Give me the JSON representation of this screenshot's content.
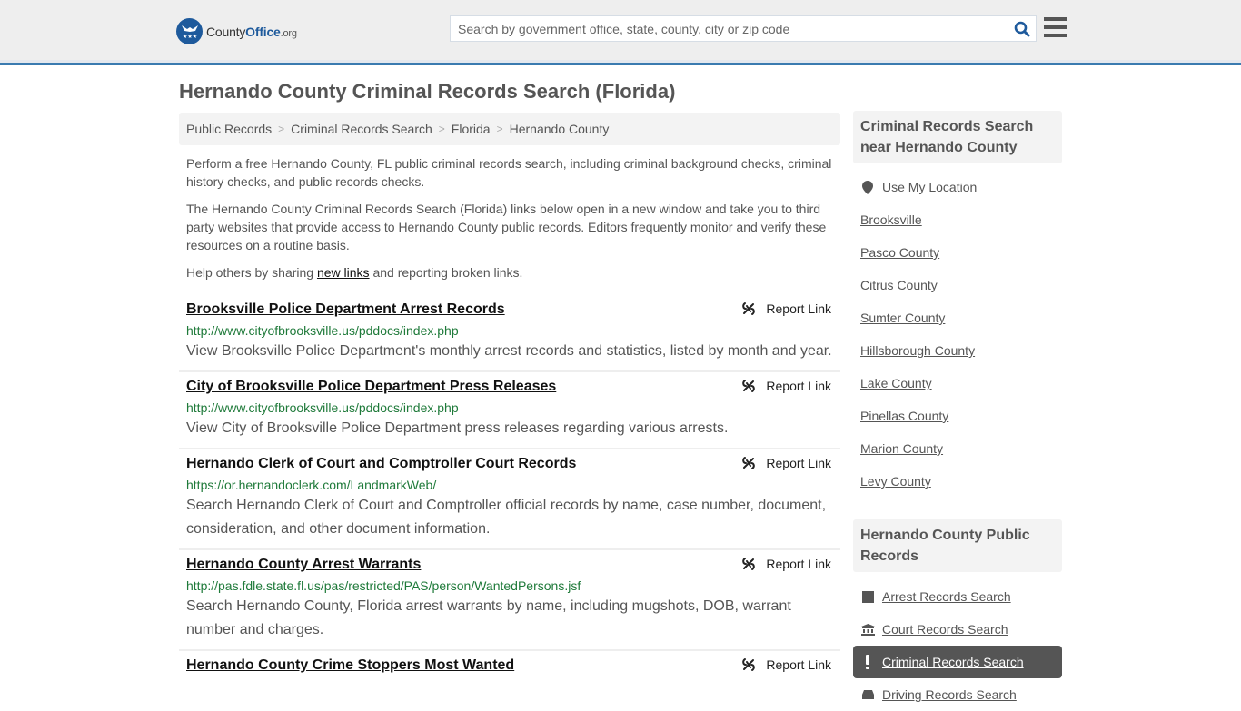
{
  "header": {
    "logo": {
      "name_main": "County",
      "name_accent": "Office",
      "tld": ".org"
    },
    "search": {
      "placeholder": "Search by government office, state, county, city or zip code",
      "value": ""
    },
    "colors": {
      "brand_blue": "#1e5a9c",
      "header_border": "#3a7bb0"
    }
  },
  "page": {
    "title": "Hernando County Criminal Records Search (Florida)",
    "breadcrumb": [
      "Public Records",
      "Criminal Records Search",
      "Florida",
      "Hernando County"
    ],
    "intro": {
      "p1": "Perform a free Hernando County, FL public criminal records search, including criminal background checks, criminal history checks, and public records checks.",
      "p2": "The Hernando County Criminal Records Search (Florida) links below open in a new window and take you to third party websites that provide access to Hernando County public records. Editors frequently monitor and verify these resources on a routine basis.",
      "p3_before": "Help others by sharing ",
      "p3_link": "new links",
      "p3_after": " and reporting broken links."
    }
  },
  "results": [
    {
      "title": "Brooksville Police Department Arrest Records",
      "url": "http://www.cityofbrooksville.us/pddocs/index.php",
      "description": "View Brooksville Police Department's monthly arrest records and statistics, listed by month and year.",
      "report_label": "Report Link"
    },
    {
      "title": "City of Brooksville Police Department Press Releases",
      "url": "http://www.cityofbrooksville.us/pddocs/index.php",
      "description": "View City of Brooksville Police Department press releases regarding various arrests.",
      "report_label": "Report Link"
    },
    {
      "title": "Hernando Clerk of Court and Comptroller Court Records",
      "url": "https://or.hernandoclerk.com/LandmarkWeb/",
      "description": "Search Hernando Clerk of Court and Comptroller official records by name, case number, document, consideration, and other document information.",
      "report_label": "Report Link"
    },
    {
      "title": "Hernando County Arrest Warrants",
      "url": "http://pas.fdle.state.fl.us/pas/restricted/PAS/person/WantedPersons.jsf",
      "description": "Search Hernando County, Florida arrest warrants by name, including mugshots, DOB, warrant number and charges.",
      "report_label": "Report Link"
    },
    {
      "title": "Hernando County Crime Stoppers Most Wanted",
      "url": "",
      "description": "",
      "report_label": "Report Link"
    }
  ],
  "sidebar": {
    "nearby": {
      "heading": "Criminal Records Search near Hernando County",
      "use_location": "Use My Location",
      "items": [
        "Brooksville",
        "Pasco County",
        "Citrus County",
        "Sumter County",
        "Hillsborough County",
        "Lake County",
        "Pinellas County",
        "Marion County",
        "Levy County"
      ]
    },
    "public_records": {
      "heading": "Hernando County Public Records",
      "items": [
        {
          "label": "Arrest Records Search",
          "icon": "square-icon",
          "active": false
        },
        {
          "label": "Court Records Search",
          "icon": "courthouse-icon",
          "active": false
        },
        {
          "label": "Criminal Records Search",
          "icon": "exclamation-icon",
          "active": true
        },
        {
          "label": "Driving Records Search",
          "icon": "car-icon",
          "active": false
        }
      ]
    }
  }
}
